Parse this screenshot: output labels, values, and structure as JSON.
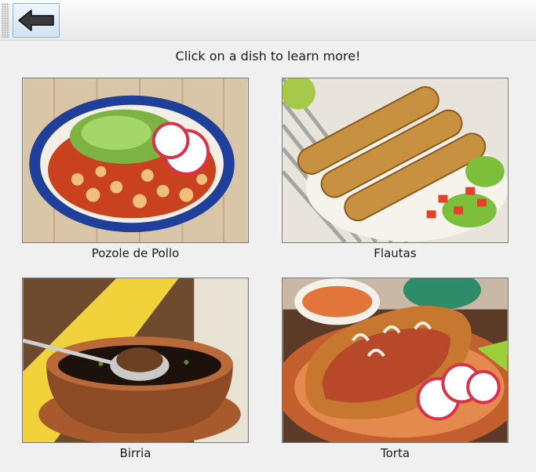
{
  "toolbar": {
    "back_icon": "left-arrow-icon"
  },
  "instruction": "Click on a dish to learn more!",
  "dishes": [
    {
      "label": "Pozole de Pollo",
      "image": "pozole-photo"
    },
    {
      "label": "Flautas",
      "image": "flautas-photo"
    },
    {
      "label": "Birria",
      "image": "birria-photo"
    },
    {
      "label": "Torta",
      "image": "torta-photo"
    }
  ],
  "colors": {
    "background": "#f0f0f0",
    "button_border": "#8fb3cf",
    "image_border": "#7a7a7a"
  }
}
